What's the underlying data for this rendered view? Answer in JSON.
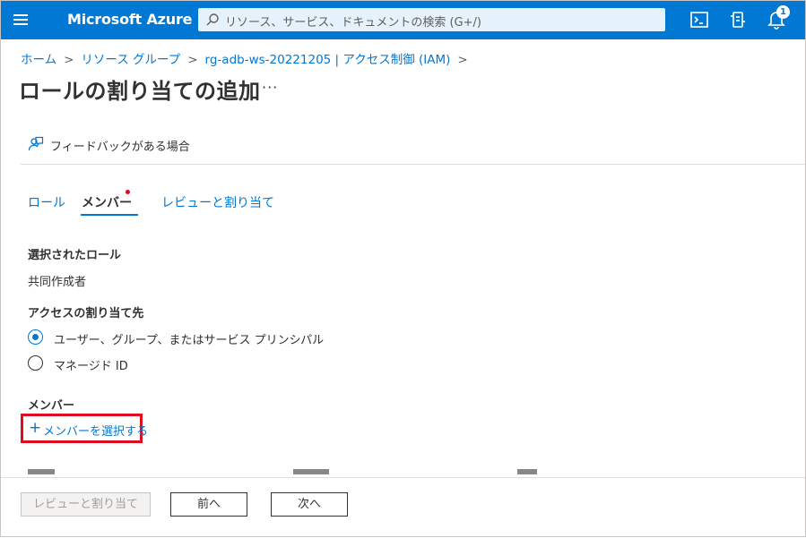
{
  "topbar": {
    "brand": "Microsoft Azure",
    "search_placeholder": "リソース、サービス、ドキュメントの検索 (G+/)",
    "notification_count": "1",
    "icons": [
      "menu-icon",
      "search-icon",
      "cloud-shell-icon",
      "directory-filter-icon",
      "notification-bell-icon"
    ],
    "accent": "#0078d4"
  },
  "breadcrumb": {
    "items": [
      "ホーム",
      "リソース グループ",
      "rg-adb-ws-20221205 | アクセス制御 (IAM)"
    ],
    "separator": ">"
  },
  "page": {
    "title": "ロールの割り当ての追加",
    "more": "···"
  },
  "feedback": {
    "label": "フィードバックがある場合",
    "icon": "feedback-icon"
  },
  "tabs": [
    {
      "label": "ロール",
      "active": false
    },
    {
      "label": "メンバー",
      "active": true,
      "required_indicator": true
    },
    {
      "label": "レビューと割り当て",
      "active": false
    }
  ],
  "form": {
    "selected_role_label": "選択されたロール",
    "selected_role_value": "共同作成者",
    "assign_access_label": "アクセスの割り当て先",
    "options": [
      {
        "label": "ユーザー、グループ、またはサービス プリンシパル",
        "checked": true
      },
      {
        "label": "マネージド ID",
        "checked": false
      }
    ],
    "members_label": "メンバー",
    "select_members_link": "メンバーを選択する",
    "highlight_color": "#e00b1c"
  },
  "footer": {
    "review_assign": "レビューと割り当て",
    "prev": "前へ",
    "next": "次へ"
  }
}
